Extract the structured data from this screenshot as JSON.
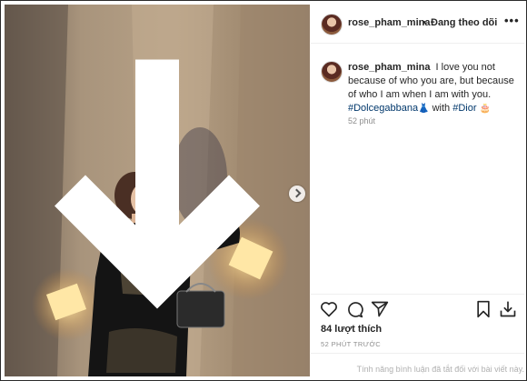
{
  "post": {
    "username": "rose_pham_mina",
    "separator": "•",
    "follow_status": "Đang theo dõi",
    "more_label": "•••",
    "caption": {
      "username": "rose_pham_mina",
      "text": "I love you not because of who you are, but because of who I am when I am with you.",
      "tag1": "#Dolcegabbana",
      "emoji1": "👗",
      "with_text": " with ",
      "tag2": "#Dior",
      "emoji2": "🎂"
    },
    "caption_time": "52 phút",
    "likes": "84 lượt thích",
    "time_ago": "52 PHÚT TRƯỚC",
    "comments_disabled": "Tính năng bình luận đã tắt đối với bài viết này."
  },
  "icons": {
    "download": "download-arrow-icon",
    "next": "chevron-right-icon",
    "like": "heart-icon",
    "comment": "comment-bubble-icon",
    "share": "paper-plane-icon",
    "save": "bookmark-icon",
    "download_post": "download-tray-icon"
  },
  "colors": {
    "tag": "#00376b",
    "muted": "#8e8e8e",
    "text": "#262626"
  }
}
